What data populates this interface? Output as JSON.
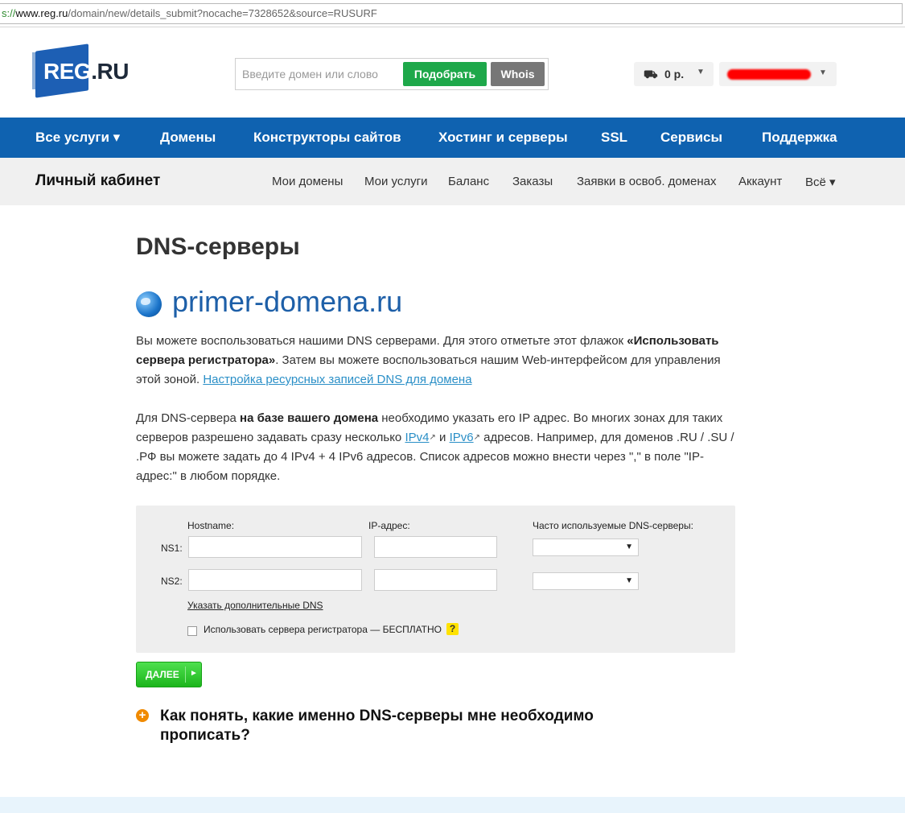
{
  "browser": {
    "url_scheme": "s://",
    "url_host": "www.reg.ru",
    "url_path": "/domain/new/details_submit?nocache=7328652&source=RUSURF"
  },
  "header": {
    "logo_main": "REG",
    "logo_suffix": ".RU",
    "search_placeholder": "Введите домен или слово",
    "pick_label": "Подобрать",
    "whois_label": "Whois",
    "balance_icon": "coins-icon",
    "balance": "0 р."
  },
  "nav": {
    "items": [
      "Все услуги ▾",
      "Домены",
      "Конструкторы сайтов",
      "Хостинг и серверы",
      "SSL",
      "Сервисы",
      "Поддержка"
    ]
  },
  "subnav": {
    "title": "Личный кабинет",
    "items": [
      "Мои домены",
      "Мои услуги",
      "Баланс",
      "Заказы",
      "Заявки в освоб. доменах",
      "Аккаунт",
      "Всё ▾"
    ]
  },
  "content": {
    "title": "DNS-серверы",
    "domain": "primer-domena.ru",
    "p1_a": "Вы можете воспользоваться нашими DNS серверами. Для этого отметьте этот флажок ",
    "p1_b": "«Использовать сервера регистратора»",
    "p1_c": ". Затем вы можете воспользоваться нашим Web-интерфейсом для управления этой зоной. ",
    "p1_link": "Настройка ресурсных записей DNS для домена",
    "p2_a": "Для DNS-сервера ",
    "p2_b": "на базе вашего домена",
    "p2_c": " необходимо указать его IP адрес. Во многих зонах для таких серверов разрешено задавать сразу несколько ",
    "p2_ipv4": "IPv4",
    "p2_and": " и ",
    "p2_ipv6": "IPv6",
    "p2_d": " адресов. Например, для доменов .RU / .SU / .РФ вы можете задать до 4 IPv4 + 4 IPv6 адресов. Список адресов можно внести через \",\" в поле \"IP-адрес:\" в любом порядке."
  },
  "form": {
    "hostname_label": "Hostname:",
    "ip_label": "IP-адрес:",
    "frequent_label": "Часто используемые DNS-серверы:",
    "ns1_label": "NS1:",
    "ns2_label": "NS2:",
    "more_dns": "Указать дополнительные DNS",
    "use_registrar": "Использовать сервера регистратора — БЕСПЛАТНО",
    "help": "?",
    "next": "ДАЛЕЕ"
  },
  "faq": {
    "question": "Как понять, какие именно DNS-серверы мне необходимо прописать?"
  },
  "colors": {
    "brand_blue": "#0f62b0",
    "green": "#1ea84a",
    "orange": "#f08a00"
  }
}
